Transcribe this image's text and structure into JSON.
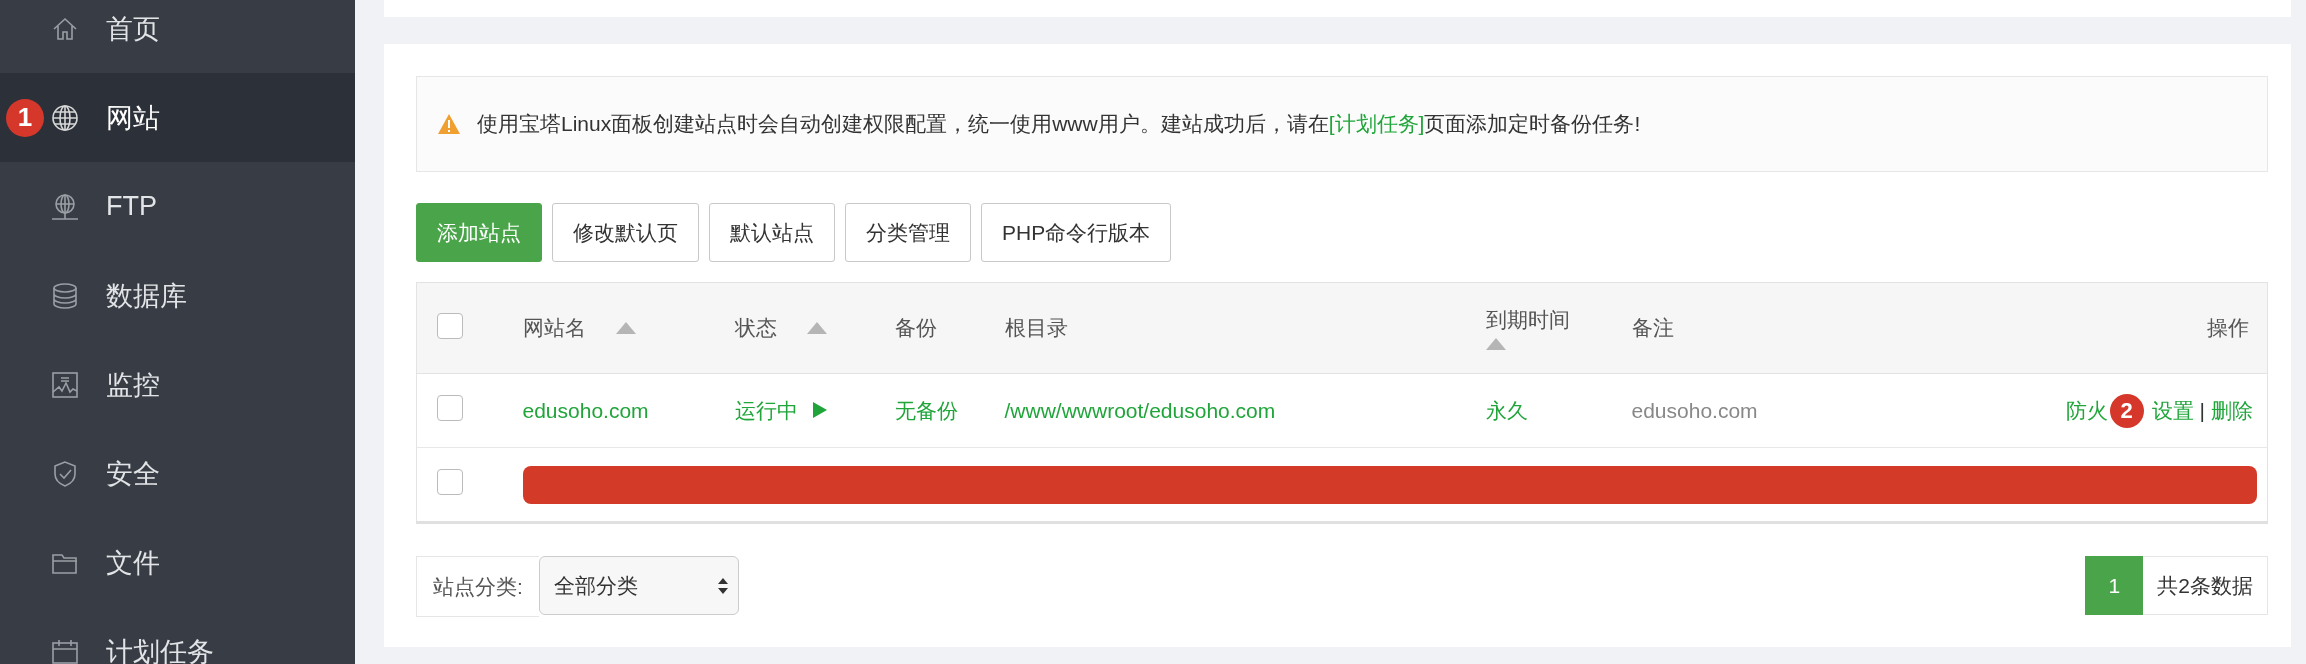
{
  "sidebar": {
    "items": [
      {
        "label": "首页",
        "selected": false
      },
      {
        "label": "网站",
        "selected": true,
        "badge": "1"
      },
      {
        "label": "FTP",
        "selected": false
      },
      {
        "label": "数据库",
        "selected": false
      },
      {
        "label": "监控",
        "selected": false
      },
      {
        "label": "安全",
        "selected": false
      },
      {
        "label": "文件",
        "selected": false
      },
      {
        "label": "计划任务",
        "selected": false
      }
    ]
  },
  "notice": {
    "parts": [
      {
        "text": "使用宝塔Linux面板创建站点时会自动创建权限配置，统一使用www用户。建站成功后，请在",
        "link": false
      },
      {
        "text": "[计划任务]",
        "link": true
      },
      {
        "text": "页面添加定时备份任务!",
        "link": false
      }
    ]
  },
  "toolbar": {
    "buttons": [
      {
        "label": "添加站点",
        "primary": true
      },
      {
        "label": "修改默认页",
        "primary": false
      },
      {
        "label": "默认站点",
        "primary": false
      },
      {
        "label": "分类管理",
        "primary": false
      },
      {
        "label": "PHP命令行版本",
        "primary": false
      }
    ]
  },
  "table": {
    "columns": [
      {
        "label": "网站名",
        "sortable": true
      },
      {
        "label": "状态",
        "sortable": true
      },
      {
        "label": "备份",
        "sortable": false
      },
      {
        "label": "根目录",
        "sortable": false
      },
      {
        "label": "到期时间",
        "sortable": true
      },
      {
        "label": "备注",
        "sortable": false
      },
      {
        "label": "操作",
        "sortable": false
      }
    ],
    "header_checked": false,
    "rows": [
      {
        "checked": false,
        "redacted": false,
        "name": "edusoho.com",
        "status": "运行中",
        "running": true,
        "backup": "无备份",
        "root": "/www/wwwroot/edusoho.com",
        "expires": "永久",
        "note": "edusoho.com",
        "actions": [
          {
            "kind": "link",
            "label": "防火",
            "badge": "2"
          },
          {
            "kind": "link",
            "label": "设置"
          },
          {
            "kind": "separator",
            "label": "|"
          },
          {
            "kind": "link",
            "label": "删除"
          }
        ]
      },
      {
        "checked": false,
        "redacted": true
      }
    ]
  },
  "footer": {
    "category_label": "站点分类:",
    "category_value": "全部分类",
    "pages": [
      {
        "label": "1",
        "selected": true
      }
    ],
    "total": "共2条数据"
  }
}
